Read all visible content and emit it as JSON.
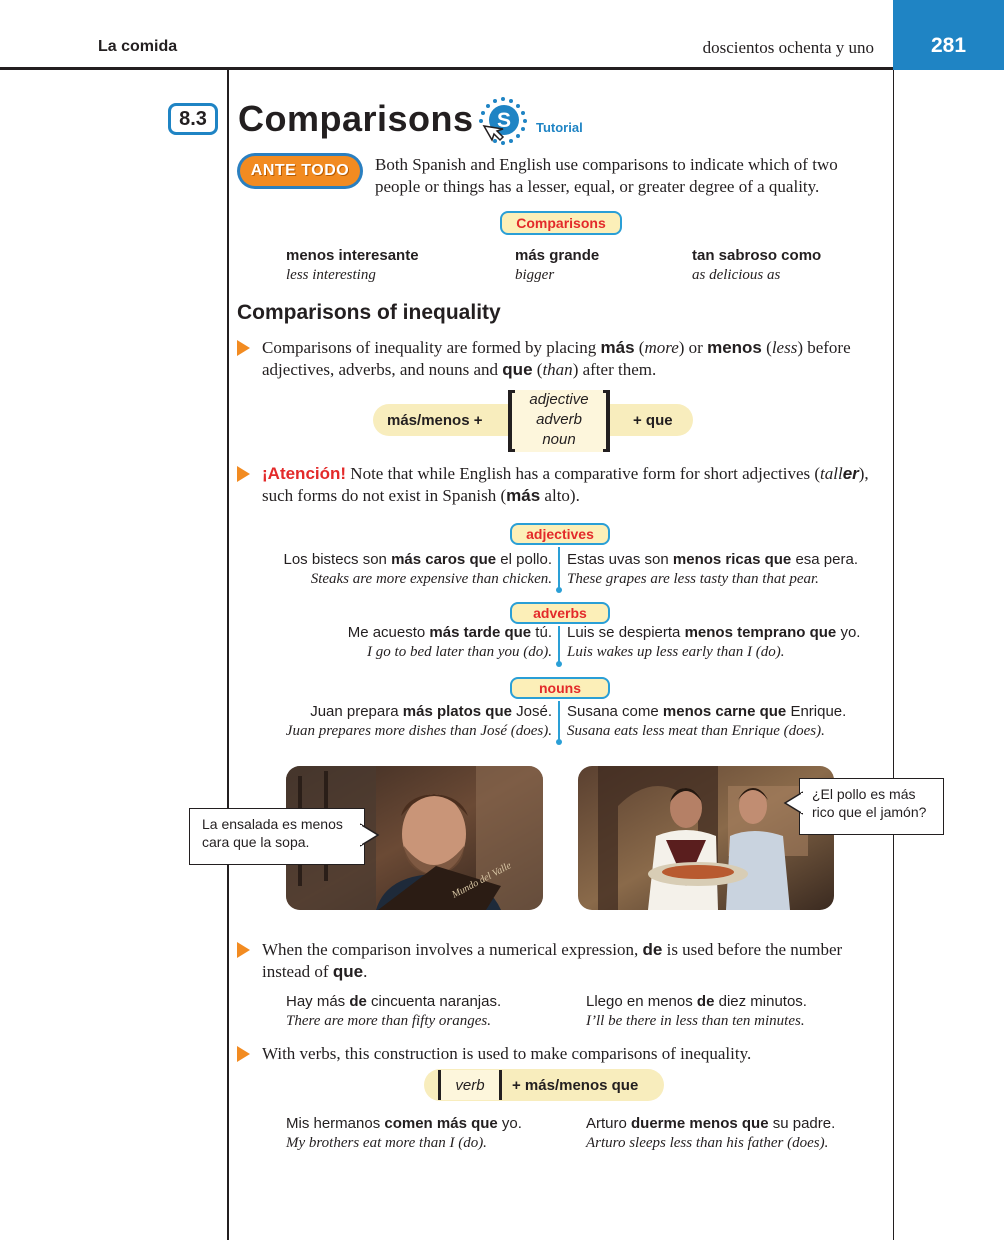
{
  "header": {
    "chapter_title": "La comida",
    "page_words": "doscientos ochenta y uno",
    "page_number": "281"
  },
  "section": {
    "number": "8.3",
    "title": "Comparisons",
    "tutorial_label": "Tutorial",
    "tutorial_icon": "S"
  },
  "ante_todo": {
    "label": "ANTE TODO",
    "text": "Both Spanish and English use comparisons to indicate which of two people or things has a lesser, equal, or greater degree of a quality."
  },
  "comparisons_pill": "Comparisons",
  "examples_top": [
    {
      "es": "menos interesante",
      "en": "less interesting"
    },
    {
      "es": "más grande",
      "en": "bigger"
    },
    {
      "es": "tan sabroso como",
      "en": "as delicious as"
    }
  ],
  "inequality": {
    "heading": "Comparisons of inequality",
    "bullet1": {
      "t1": "Comparisons of inequality are formed by placing ",
      "b1": "más",
      "t2": " (",
      "i1": "more",
      "t3": ") or ",
      "b2": "menos",
      "t4": " (",
      "i2": "less",
      "t5": ") before adjectives, adverbs, and nouns and ",
      "b3": "que",
      "t6": " (",
      "i3": "than",
      "t7": ") after them."
    },
    "formula": {
      "left": "más/menos +",
      "items": [
        "adjective",
        "adverb",
        "noun"
      ],
      "right": "+ que"
    },
    "bullet2": {
      "atencion": "¡Atención!",
      "t1": " Note that while English has a comparative form for short adjectives (",
      "i1": "tall",
      "bi1": "er",
      "t2": "), such forms do not exist in Spanish (",
      "b1": "más",
      "t3": " alto)."
    }
  },
  "groups": [
    {
      "label": "adjectives",
      "left": {
        "pre": "Los bistecs son ",
        "bold": "más caros que",
        "post": " el pollo.",
        "en": "Steaks are more expensive than chicken."
      },
      "right": {
        "pre": "Estas uvas son ",
        "bold": "menos ricas que",
        "post": " esa pera.",
        "en": "These grapes are less tasty than that pear."
      }
    },
    {
      "label": "adverbs",
      "left": {
        "pre": "Me acuesto ",
        "bold": "más tarde que",
        "post": " tú.",
        "en": "I go to bed later than you (do)."
      },
      "right": {
        "pre": "Luis se despierta ",
        "bold": "menos temprano que",
        "post": " yo.",
        "en": "Luis wakes up less early than I (do)."
      }
    },
    {
      "label": "nouns",
      "left": {
        "pre": "Juan prepara ",
        "bold": "más platos que",
        "post": " José.",
        "en": "Juan prepares more dishes than José (does)."
      },
      "right": {
        "pre": "Susana come ",
        "bold": "menos carne que",
        "post": " Enrique.",
        "en": "Susana eats less meat than Enrique (does)."
      }
    }
  ],
  "photos": {
    "bubble_left": "La ensalada es menos cara que la sopa.",
    "bubble_right": "¿El pollo es más rico que el jamón?",
    "menu_text": "Mundo del Valle"
  },
  "numerical": {
    "t1": "When the comparison involves a numerical expression, ",
    "b1": "de",
    "t2": " is used before the number instead of ",
    "b2": "que",
    "t3": ".",
    "ex_left": {
      "pre": "Hay más ",
      "bold": "de",
      "post": " cincuenta naranjas.",
      "en": "There are more than fifty oranges."
    },
    "ex_right": {
      "pre": "Llego en menos ",
      "bold": "de",
      "post": " diez minutos.",
      "en": "I’ll be there in less than ten minutes."
    }
  },
  "verbs": {
    "text": "With verbs, this construction is used to make comparisons of inequality.",
    "formula_verb": "verb",
    "formula_rest": "+ más/menos que",
    "ex_left": {
      "pre": "Mis hermanos ",
      "bold": "comen más que",
      "post": " yo.",
      "en": "My brothers eat more than I (do)."
    },
    "ex_right": {
      "pre": "Arturo ",
      "bold": "duerme menos que",
      "post": " su padre.",
      "en": "Arturo sleeps less than his father (does)."
    }
  },
  "colors": {
    "accent_blue": "#1f84c4",
    "bullet_orange": "#f28b21",
    "attention_red": "#e32a2a",
    "pill_fill": "#fcefb8"
  }
}
